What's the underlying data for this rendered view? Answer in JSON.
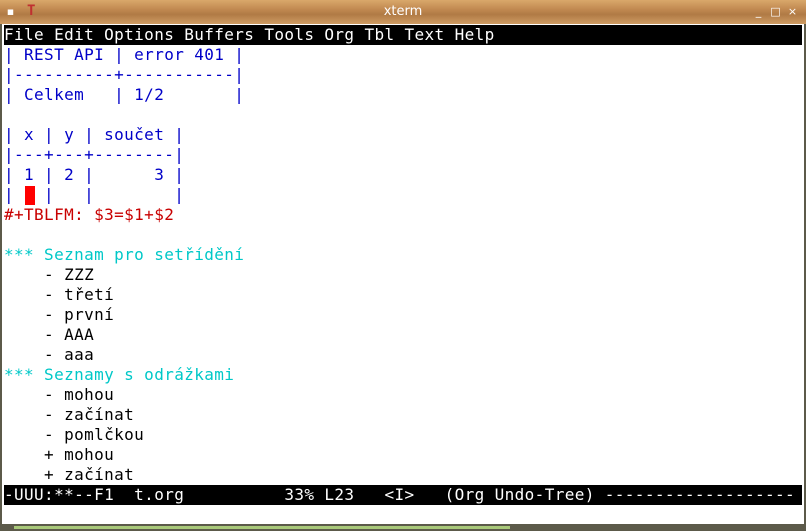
{
  "window": {
    "title": "xterm",
    "minimize": "_",
    "maximize": "□",
    "close": "×"
  },
  "menu": "File Edit Options Buffers Tools Org Tbl Text Help",
  "lines": [
    {
      "text": "| REST API | error 401 |",
      "color": "blue"
    },
    {
      "text": "|----------+-----------|",
      "color": "blue"
    },
    {
      "text": "| Celkem   | 1/2       |",
      "color": "blue"
    },
    {
      "text": "",
      "color": "black"
    },
    {
      "text": "| x | y | součet |",
      "color": "blue"
    },
    {
      "text": "|---+---+--------|",
      "color": "blue"
    },
    {
      "text": "| 1 | 2 |      3 |",
      "color": "blue"
    },
    {
      "text": "|   |   |        |",
      "color": "blue"
    },
    {
      "text": "#+TBLFM: $3=$1+$2",
      "color": "red"
    },
    {
      "text": "",
      "color": "black"
    },
    {
      "text": "*** Seznam pro setřídění",
      "color": "cyan"
    },
    {
      "text": "    - ZZZ",
      "color": "black"
    },
    {
      "text": "    - třetí",
      "color": "black"
    },
    {
      "text": "    - první",
      "color": "black"
    },
    {
      "text": "    - AAA",
      "color": "black"
    },
    {
      "text": "    - aaa",
      "color": "black"
    },
    {
      "text": "*** Seznamy s odrážkami",
      "color": "cyan"
    },
    {
      "text": "    - mohou",
      "color": "black"
    },
    {
      "text": "    - začínat",
      "color": "black"
    },
    {
      "text": "    - pomlčkou",
      "color": "black"
    },
    {
      "text": "    + mohou",
      "color": "black"
    },
    {
      "text": "    + začínat",
      "color": "black"
    }
  ],
  "modeline": "-UUU:**--F1  t.org          33% L23   <I>   (Org Undo-Tree) -------------------"
}
